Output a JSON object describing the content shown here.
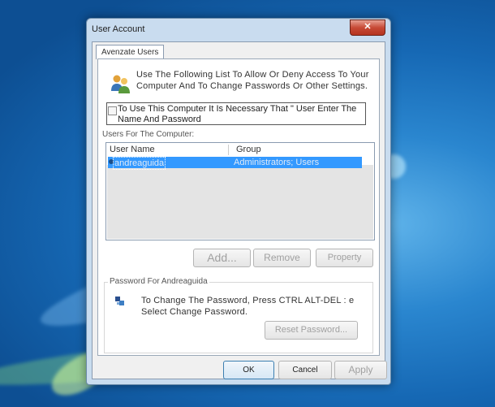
{
  "window": {
    "title": "User Account",
    "close_glyph": "✕"
  },
  "tabs": [
    {
      "label": "Avenzate Users"
    }
  ],
  "intro_text": "Use The Following List To Allow Or Deny Access To Your Computer And To Change Passwords Or Other Settings.",
  "require_password": {
    "label": "To Use This Computer It Is Necessary That \" User Enter The Name And Password",
    "checked": false
  },
  "users_group_label": "Users For The Computer:",
  "users_table": {
    "columns": [
      "User Name",
      "Group"
    ],
    "rows": [
      {
        "user": "andreaguida",
        "group": "Administrators; Users",
        "selected": true
      }
    ]
  },
  "buttons": {
    "add": "Add...",
    "remove": "Remove",
    "properties": "Property",
    "reset_password": "Reset Password...",
    "ok": "OK",
    "cancel": "Cancel",
    "apply": "Apply"
  },
  "password_section": {
    "legend": "Password For Andreaguida",
    "text": "To Change The Password, Press CTRL ALT-DEL : e Select Change Password."
  },
  "icons": {
    "users": "users-icon",
    "key": "key-icon"
  },
  "colors": {
    "selection": "#3399ff",
    "close_button": "#c74a36",
    "desktop": "#1668b4"
  }
}
